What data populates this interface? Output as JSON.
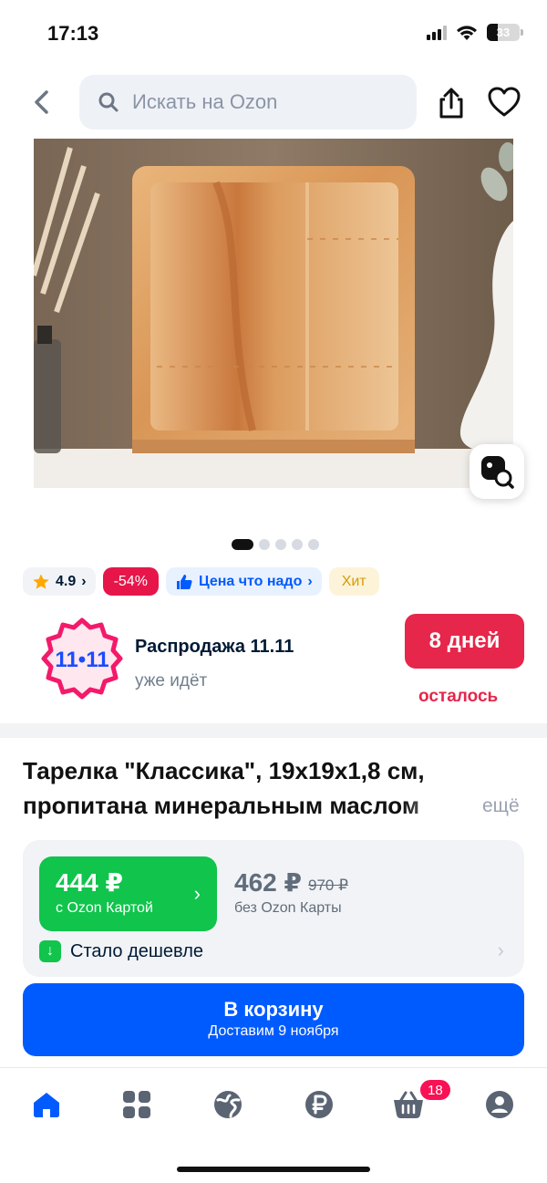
{
  "status_bar": {
    "time": "17:13",
    "battery": "33"
  },
  "header": {
    "search_placeholder": "Искать на Ozon"
  },
  "gallery": {
    "image_alt": "Деревянная квадратная тарелка",
    "pages": 5,
    "active_page": 1
  },
  "badges": {
    "rating": "4.9",
    "discount": "-54%",
    "price_label": "Цена что надо",
    "hit": "Хит"
  },
  "sale": {
    "logo_text": "11•11",
    "title": "Распродажа 11.11",
    "subtitle": "уже идёт",
    "days": "8 дней",
    "left": "осталось"
  },
  "product": {
    "title_line1": "Тарелка \"Классика\", 19х19х1,8 см,",
    "title_line2": "пропитана минеральным маслом",
    "more": "ещё"
  },
  "price": {
    "ozon_price": "444 ₽",
    "ozon_label": "с Ozon Картой",
    "regular_price": "462 ₽",
    "old_price": "970 ₽",
    "regular_label": "без Ozon Карты",
    "cheaper": "Стало дешевле"
  },
  "cart_button": {
    "label": "В корзину",
    "delivery": "Доставим 9 ноября"
  },
  "tabbar": {
    "cart_count": "18"
  },
  "colors": {
    "accent": "#005bff",
    "sale": "#e6264a",
    "green": "#10c44c"
  }
}
